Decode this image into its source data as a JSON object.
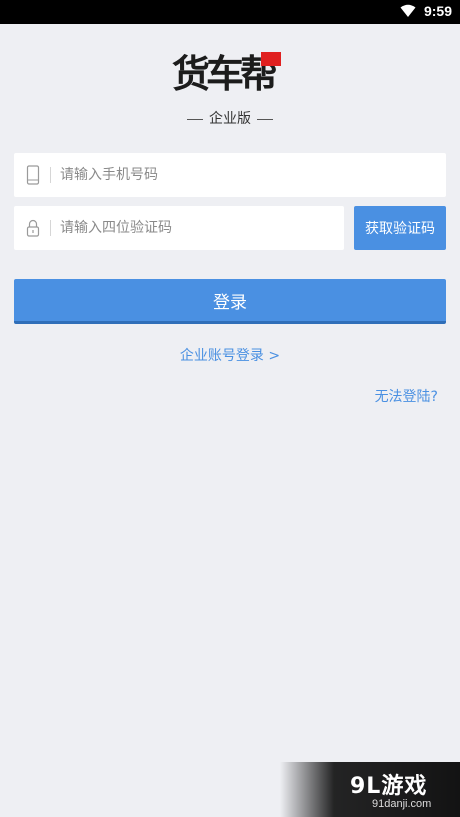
{
  "status_bar": {
    "time": "9:59",
    "icons": [
      "wifi-icon"
    ]
  },
  "logo": {
    "text": "货车帮"
  },
  "edition": {
    "label": "企业版"
  },
  "form": {
    "phone": {
      "placeholder": "请输入手机号码",
      "value": "",
      "icon": "phone-icon"
    },
    "code": {
      "placeholder": "请输入四位验证码",
      "value": "",
      "icon": "lock-icon"
    },
    "get_code_label": "获取验证码",
    "login_label": "登录"
  },
  "links": {
    "enterprise_login": "企业账号登录 >",
    "cannot_login": "无法登陆?"
  },
  "watermark": {
    "title": "9L游戏",
    "url": "91danji.com"
  },
  "colors": {
    "accent": "#4a90e2",
    "background": "#eeeff3",
    "logo_flag": "#e02020"
  }
}
